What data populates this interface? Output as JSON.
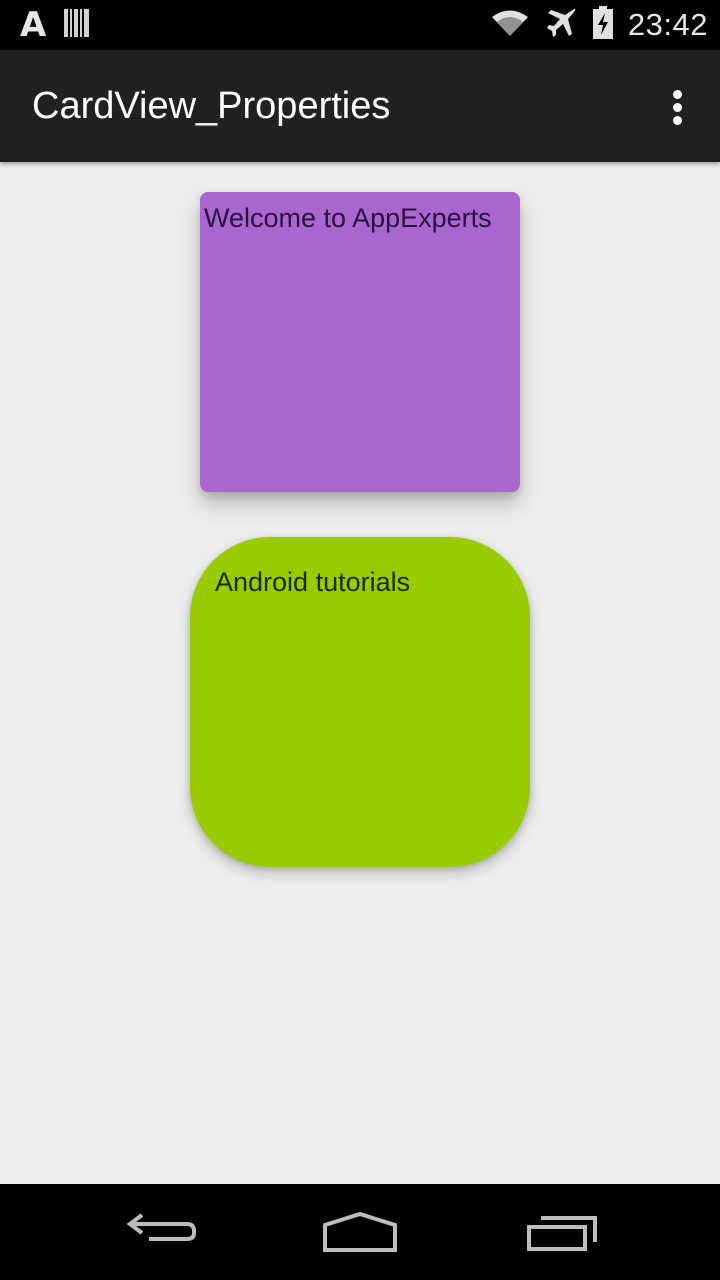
{
  "status_bar": {
    "left_icons": [
      "app-notification-icon",
      "barcode-icon"
    ],
    "left_icon_glyph": "A",
    "right_icons": [
      "wifi-icon",
      "airplane-mode-icon",
      "battery-charging-icon"
    ],
    "time": "23:42"
  },
  "action_bar": {
    "title": "CardView_Properties",
    "overflow_icon": "overflow-menu-icon"
  },
  "cards": [
    {
      "text": "Welcome to AppExperts",
      "color": "#a966cf"
    },
    {
      "text": "Android tutorials",
      "color": "#99cc00"
    }
  ],
  "colors": {
    "action_bar": "#212121",
    "background": "#eeeeee",
    "status_bar": "#000000"
  },
  "nav_bar": {
    "buttons": [
      "back-icon",
      "home-icon",
      "recents-icon"
    ]
  }
}
